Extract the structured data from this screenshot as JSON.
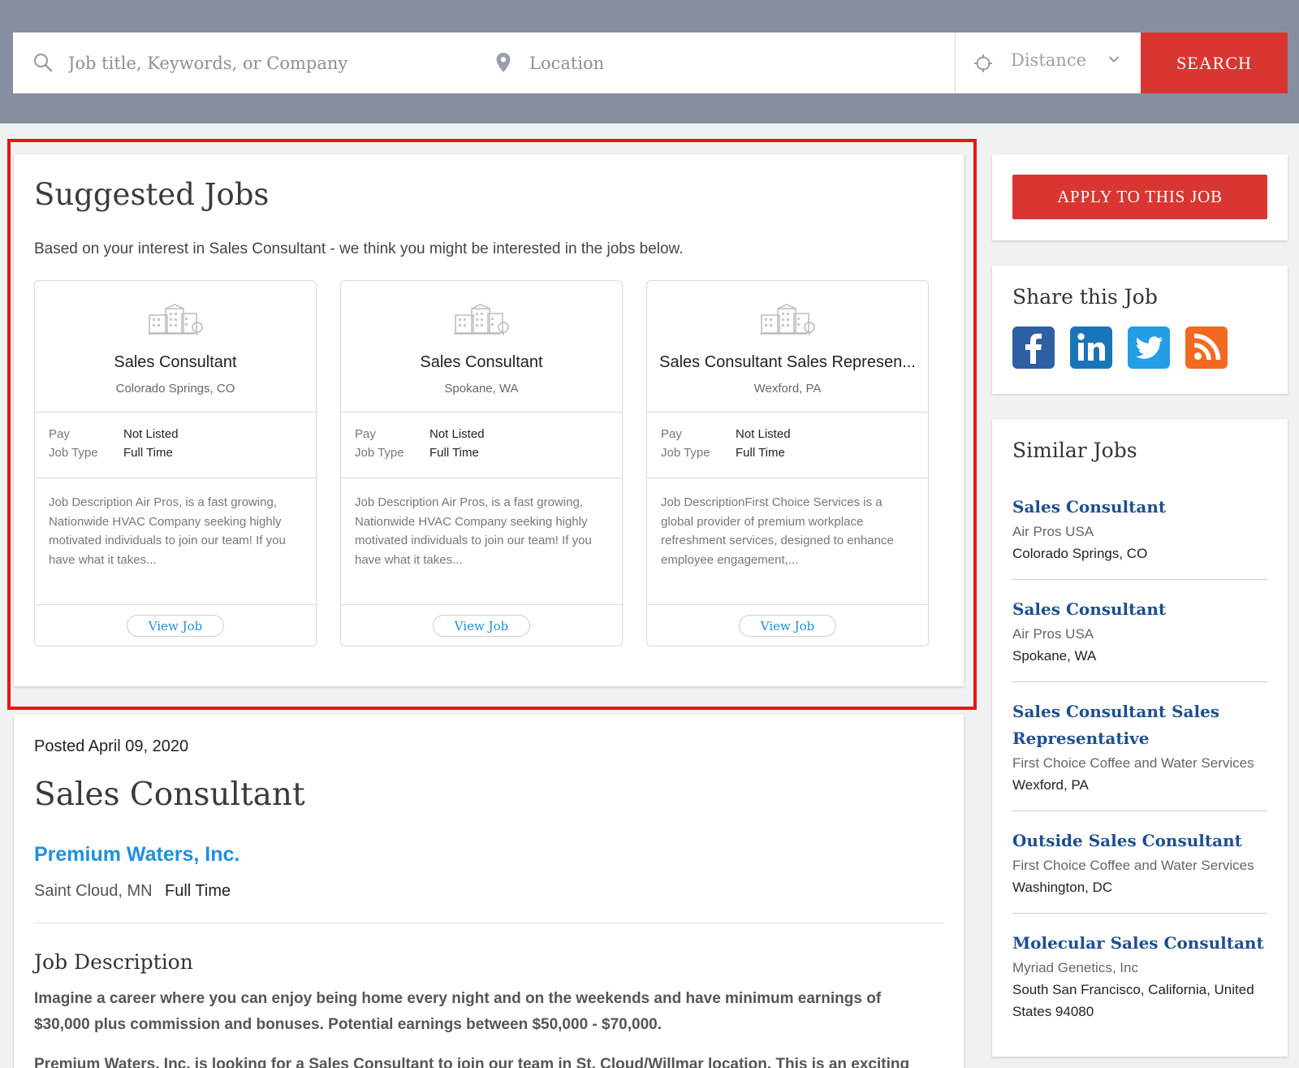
{
  "search": {
    "keyword_placeholder": "Job title, Keywords, or Company",
    "location_placeholder": "Location",
    "distance_placeholder": "Distance",
    "button_label": "SEARCH"
  },
  "suggested": {
    "title": "Suggested Jobs",
    "subtitle": "Based on your interest in Sales Consultant - we think you might be interested in the jobs below.",
    "pay_label": "Pay",
    "job_type_label": "Job Type",
    "view_label": "View Job",
    "cards": [
      {
        "title": "Sales Consultant",
        "location": "Colorado Springs, CO",
        "pay": "Not Listed",
        "job_type": "Full Time",
        "description": "Job Description Air Pros, is a fast growing, Nationwide HVAC Company seeking highly motivated individuals to join our team! If you have what it takes..."
      },
      {
        "title": "Sales Consultant",
        "location": "Spokane, WA",
        "pay": "Not Listed",
        "job_type": "Full Time",
        "description": "Job Description Air Pros, is a fast growing, Nationwide HVAC Company seeking highly motivated individuals to join our team! If you have what it takes..."
      },
      {
        "title": "Sales Consultant Sales Represen...",
        "location": "Wexford, PA",
        "pay": "Not Listed",
        "job_type": "Full Time",
        "description": "Job DescriptionFirst Choice Services is a global provider of premium workplace refreshment services, designed to enhance employee engagement,..."
      }
    ]
  },
  "job": {
    "posted": "Posted April 09, 2020",
    "title": "Sales Consultant",
    "company": "Premium Waters, Inc.",
    "location": "Saint Cloud, MN",
    "type": "Full Time",
    "description_heading": "Job Description",
    "description_lead": "Imagine a career where you can enjoy being home every night and on the weekends and have minimum earnings of $30,000 plus commission and bonuses. Potential earnings between $50,000 - $70,000.",
    "description_cut": "Premium Waters, Inc. is looking for a Sales Consultant to join our team in St. Cloud/Willmar location. This is an exciting"
  },
  "sidebar": {
    "apply_label": "APPLY TO THIS JOB",
    "share_title": "Share this Job",
    "social": [
      {
        "name": "facebook-icon",
        "color": "#2f5fa3"
      },
      {
        "name": "linkedin-icon",
        "color": "#1a74b8"
      },
      {
        "name": "twitter-icon",
        "color": "#229de6"
      },
      {
        "name": "rss-icon",
        "color": "#f26a21"
      }
    ],
    "similar_title": "Similar Jobs",
    "similar": [
      {
        "title": "Sales Consultant",
        "company": "Air Pros USA",
        "location": "Colorado Springs, CO"
      },
      {
        "title": "Sales Consultant",
        "company": "Air Pros USA",
        "location": "Spokane, WA"
      },
      {
        "title": "Sales Consultant Sales Representative",
        "company": "First Choice Coffee and Water Services",
        "location": "Wexford, PA"
      },
      {
        "title": "Outside Sales Consultant",
        "company": "First Choice Coffee and Water Services",
        "location": "Washington, DC"
      },
      {
        "title": "Molecular Sales Consultant",
        "company": "Myriad Genetics, Inc",
        "location": "South San Francisco, California, United States 94080"
      }
    ]
  }
}
